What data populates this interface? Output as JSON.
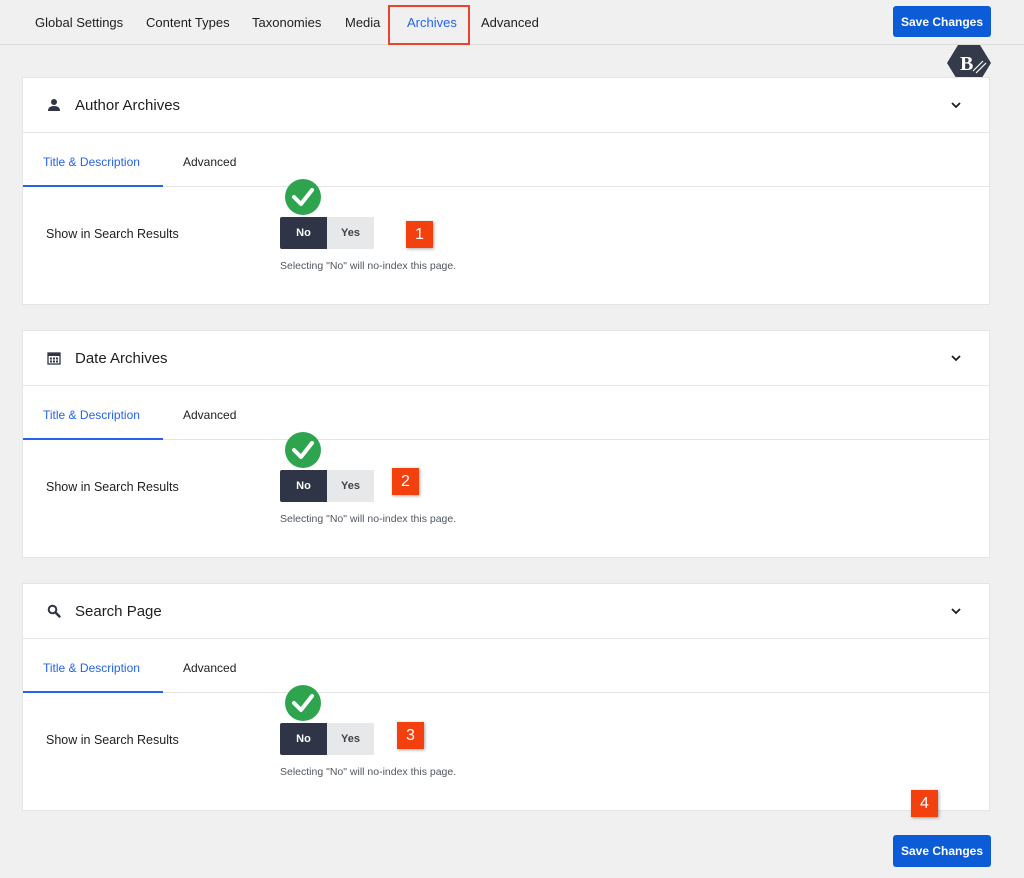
{
  "nav": {
    "tabs": [
      "Global Settings",
      "Content Types",
      "Taxonomies",
      "Media",
      "Archives",
      "Advanced"
    ],
    "active": "Archives",
    "save_label": "Save Changes"
  },
  "cards": [
    {
      "title": "Author Archives",
      "icon": "user-icon",
      "subtabs": [
        "Title & Description",
        "Advanced"
      ],
      "field_label": "Show in Search Results",
      "toggle": {
        "on": "No",
        "off": "Yes"
      },
      "helper": "Selecting \"No\" will no-index this page.",
      "badge": "1"
    },
    {
      "title": "Date Archives",
      "icon": "calendar-icon",
      "subtabs": [
        "Title & Description",
        "Advanced"
      ],
      "field_label": "Show in Search Results",
      "toggle": {
        "on": "No",
        "off": "Yes"
      },
      "helper": "Selecting \"No\" will no-index this page.",
      "badge": "2"
    },
    {
      "title": "Search Page",
      "icon": "search-icon",
      "subtabs": [
        "Title & Description",
        "Advanced"
      ],
      "field_label": "Show in Search Results",
      "toggle": {
        "on": "No",
        "off": "Yes"
      },
      "helper": "Selecting \"No\" will no-index this page.",
      "badge": "3"
    }
  ],
  "footer": {
    "save_label": "Save Changes",
    "badge": "4"
  },
  "colors": {
    "accent": "#0b5cd6",
    "active_tab": "#2563eb",
    "badge": "#f2400f",
    "check": "#2ea44f",
    "toggle_on": "#2f3447"
  }
}
